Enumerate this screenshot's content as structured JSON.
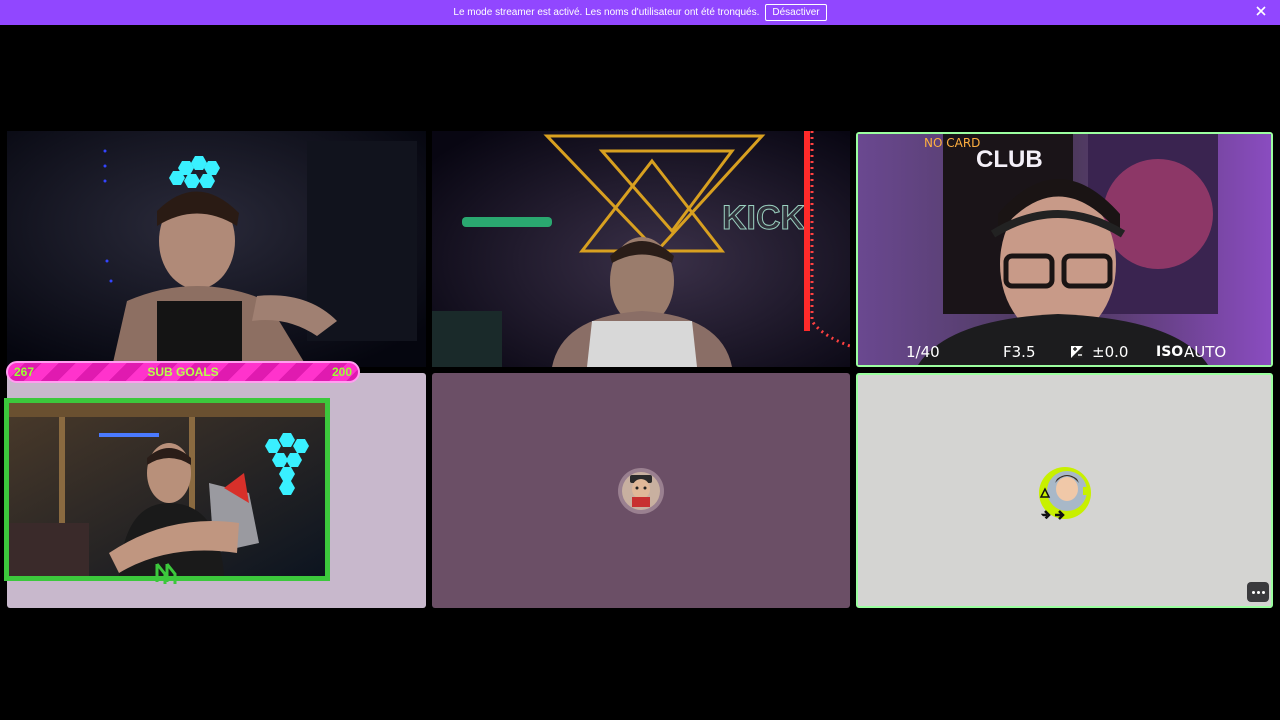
{
  "banner": {
    "message": "Le mode streamer est activé. Les noms d'utilisateur ont été tronqués.",
    "button_label": "Désactiver"
  },
  "streams": {
    "stream3": {
      "camera_overlay": {
        "no_card": "NO CARD",
        "shutter": "1/40",
        "aperture": "F3.5",
        "exposure": "±0.0",
        "iso_label": "ISO",
        "iso_value": "AUTO"
      },
      "poster_text": "CLUB"
    },
    "stream2": {
      "sign_text": "KICK"
    },
    "stream4": {
      "sub_goals": {
        "current": "267",
        "title": "SUB GOALS",
        "target": "200"
      }
    }
  },
  "colors": {
    "banner": "#9147ff",
    "tile4_bg": "#c8b8cc",
    "tile5_bg": "#6b4f66",
    "tile6_bg": "#d4d4d2",
    "active_border": "#9cffa0"
  },
  "icons": {
    "close": "close-icon",
    "more": "more-options-icon"
  }
}
